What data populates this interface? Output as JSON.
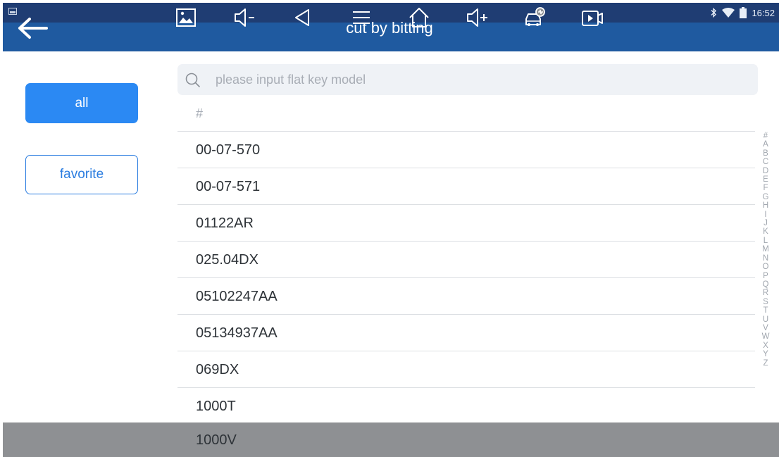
{
  "status_bar": {
    "time": "16:52",
    "icons": [
      "bluetooth-icon",
      "wifi-icon",
      "battery-icon"
    ]
  },
  "header": {
    "title": "cut by bitting"
  },
  "filters": {
    "all_label": "all",
    "favorite_label": "favorite"
  },
  "search": {
    "placeholder": "please input flat key model",
    "value": ""
  },
  "list": {
    "section_header": "#",
    "items": [
      {
        "label": "00-07-570"
      },
      {
        "label": "00-07-571"
      },
      {
        "label": "01122AR"
      },
      {
        "label": "025.04DX"
      },
      {
        "label": "05102247AA"
      },
      {
        "label": "05134937AA"
      },
      {
        "label": "069DX"
      },
      {
        "label": "1000T"
      }
    ],
    "partially_visible_item": "1000V"
  },
  "alphabet_index": [
    "#",
    "A",
    "B",
    "C",
    "D",
    "E",
    "F",
    "G",
    "H",
    "I",
    "J",
    "K",
    "L",
    "M",
    "N",
    "O",
    "P",
    "Q",
    "R",
    "S",
    "T",
    "U",
    "V",
    "W",
    "X",
    "Y",
    "Z"
  ],
  "nav_bar": {
    "icons": [
      "screenshot-icon",
      "volume-down-icon",
      "back-triangle-icon",
      "menu-icon",
      "home-icon",
      "volume-up-icon",
      "car-diagnostic-icon",
      "screen-record-icon"
    ]
  },
  "colors": {
    "status_bar": "#1f3d73",
    "title_bar": "#1f5aa0",
    "accent": "#2b89f3",
    "nav_bar": "#8e9093"
  }
}
